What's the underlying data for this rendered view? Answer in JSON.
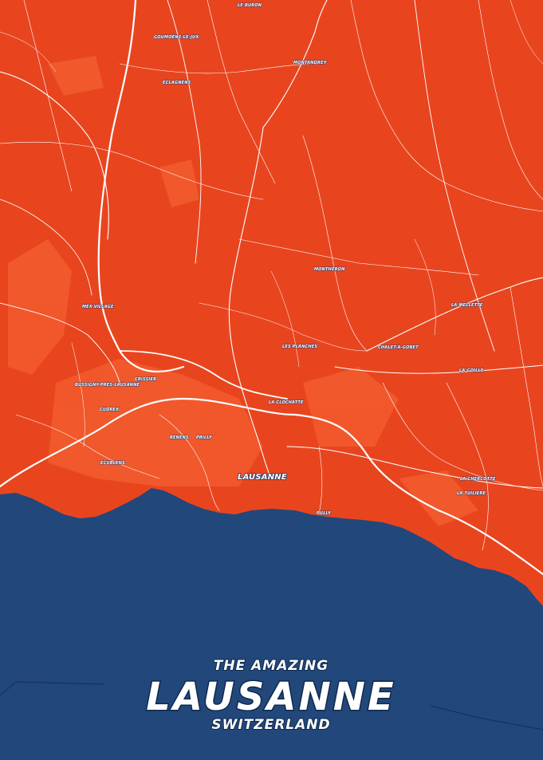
{
  "colors": {
    "land": "#e8451f",
    "land_highlight": "#f25a2c",
    "water": "#22477a",
    "roads": "#ffffff"
  },
  "poster": {
    "line1": "THE AMAZING",
    "city": "LAUSANNE",
    "country": "SWITZERLAND"
  },
  "places": {
    "le_buron": "LE BURON",
    "goumoens": "GOUMOËNS-LE-JUX",
    "montandrey": "MONTANDREY",
    "eclagnens": "ECLAGNENS",
    "montheron": "MONTHERON",
    "mex_village": "MEX VILLAGE",
    "la_mellette": "LA MELLETTE",
    "les_planches": "LES PLANCHES",
    "chalet_a_gobet": "CHALET-À-GOBET",
    "la_goille": "LA GOILLE",
    "crissier": "CRISSIER",
    "bussigny": "BUSSIGNY-PRÈS-LAUSANNE",
    "la_clochatte": "LA CLOCHATTE",
    "chavannes": "CUDREX",
    "renens": "RENENS",
    "prilly": "PRILLY",
    "ecublens": "ECUBLENS",
    "lausanne": "LAUSANNE",
    "la_chercotte": "LA CHERCOTTE",
    "la_tuilierie": "LA TUILIERE",
    "pully": "PULLY"
  }
}
